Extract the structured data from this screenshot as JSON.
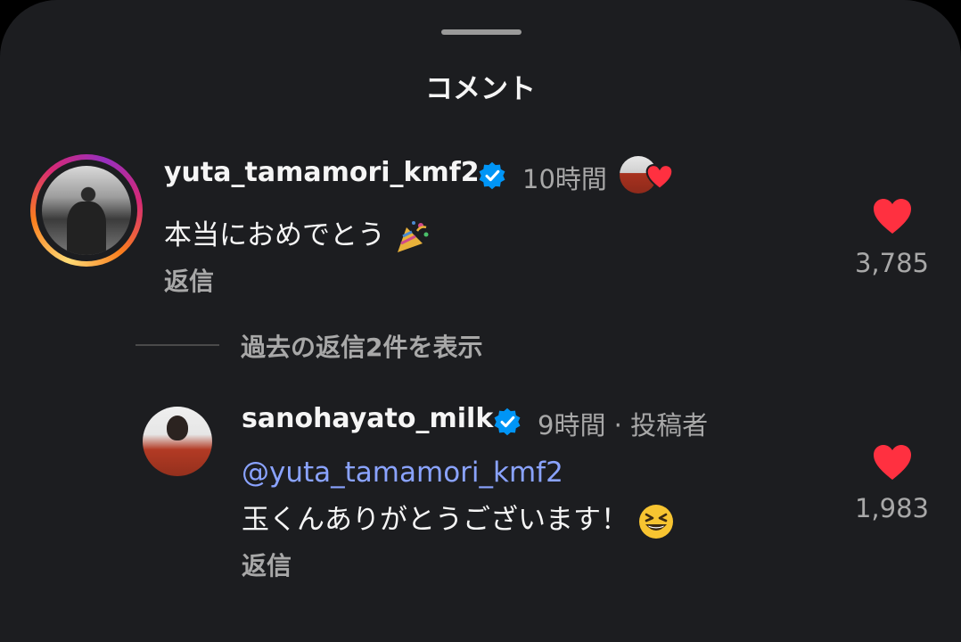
{
  "sheet": {
    "title": "コメント"
  },
  "comments": [
    {
      "username": "yuta_tamamori_kmf2",
      "verified": true,
      "time": "10時間",
      "liked_by_creator": true,
      "text": "本当におめでとう",
      "text_emoji": "party-popper-icon",
      "reply_label": "返信",
      "like_count": "3,785",
      "liked": true
    },
    {
      "username": "sanohayato_milk",
      "verified": true,
      "time": "9時間 · 投稿者",
      "mention": "@yuta_tamamori_kmf2",
      "text": "玉くんありがとうございます！",
      "text_emoji": "grinning-squinting-face-icon",
      "reply_label": "返信",
      "like_count": "1,983",
      "liked": true
    }
  ],
  "view_replies": {
    "label": "過去の返信2件を表示"
  },
  "colors": {
    "background": "#1c1d20",
    "heart": "#ff3040",
    "verified": "#0095f6",
    "mention": "#8aa3ff",
    "secondary_text": "#a8a8a8"
  }
}
